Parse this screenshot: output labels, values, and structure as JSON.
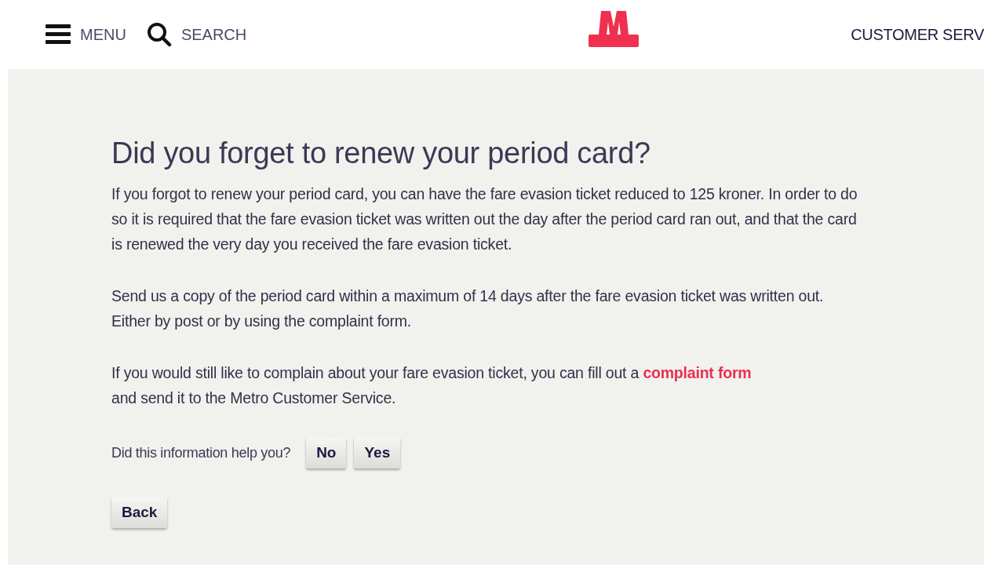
{
  "header": {
    "menu": "MENU",
    "search": "SEARCH",
    "customer_service": "CUSTOMER SERV"
  },
  "article": {
    "title": "Did you forget to renew your period card?",
    "paragraphs": [
      {
        "text": "If you forgot to renew your period card, you can have the fare evasion ticket reduced to 125 kroner. In order to do so it is required that the fare evasion ticket was written out the day after the period card ran out, and that the card is renewed the very day you received the fare evasion ticket."
      },
      {
        "text": "Send us a copy of the period card within a maximum of 14 days after the fare evasion ticket was written out. Either by post or by using the complaint form."
      },
      {
        "text": "If you would still like to complain about your fare evasion ticket, you can fill out a",
        "link": "complaint form",
        "after": "and send it to the Metro Customer Service."
      }
    ]
  },
  "feedback": {
    "question": "Did this information help you?",
    "buttons": [
      "No",
      "Yes"
    ]
  },
  "back_button": "Back"
}
